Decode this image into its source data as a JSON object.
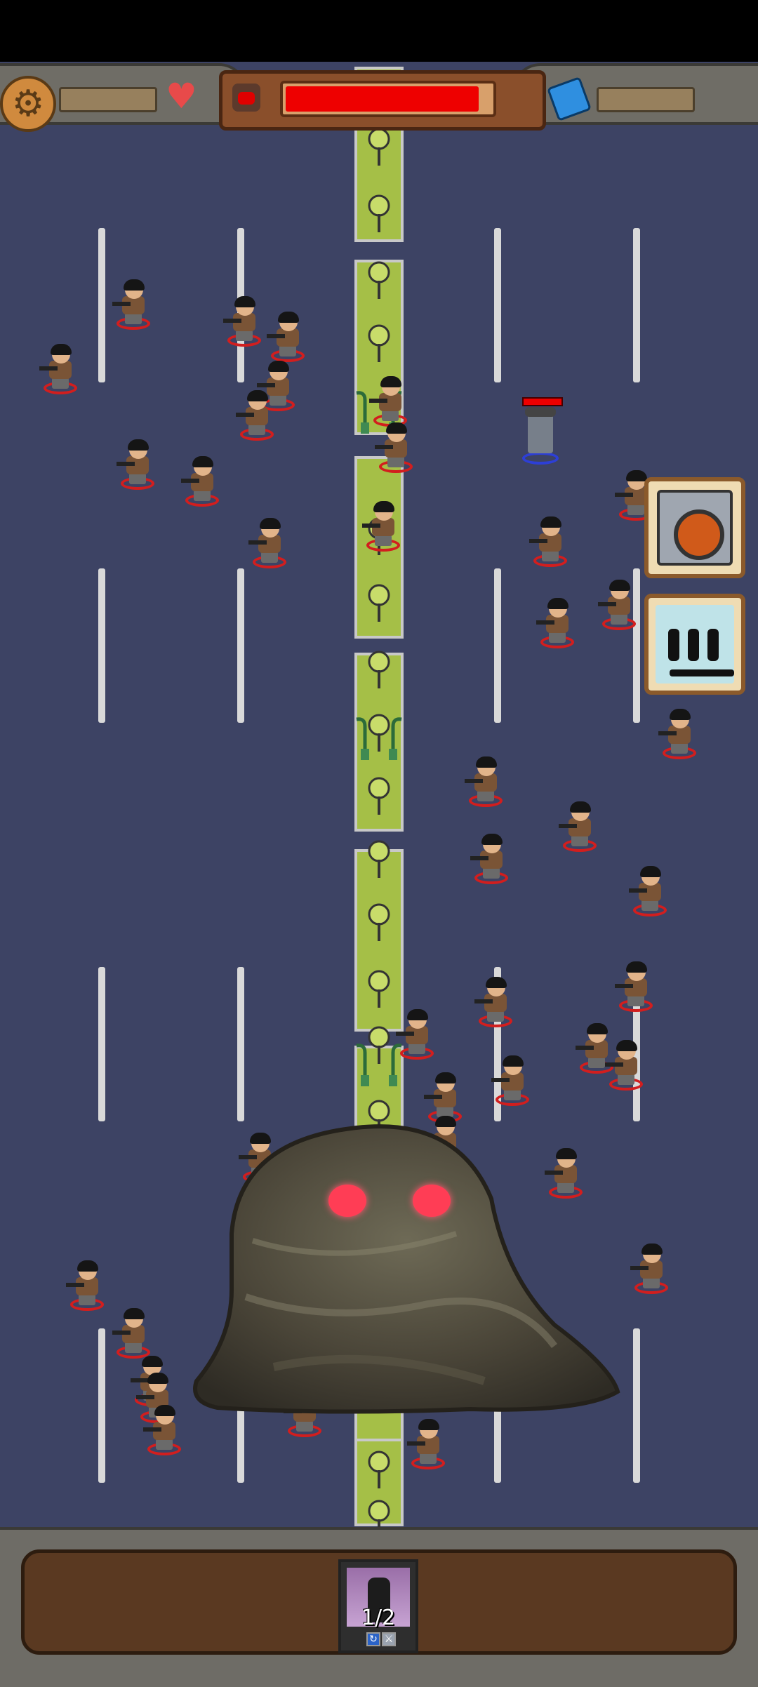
{
  "hud": {
    "settings_icon": "gear-icon",
    "lives_icon": "heart-icon",
    "currency_icon": "cube-icon",
    "boss_health_fraction": 0.97,
    "colors": {
      "boss_health": "#ee0000",
      "field": "#3d4364",
      "median": "#a5bf47"
    }
  },
  "side_buttons": [
    {
      "icon": "camera-icon"
    },
    {
      "icon": "weapons-icon"
    }
  ],
  "hero": {
    "health_fraction": 1.0
  },
  "unit_bar": {
    "units": [
      {
        "count": "1/2",
        "icons": [
          "cycle-icon",
          "weapon-icon"
        ]
      }
    ]
  }
}
